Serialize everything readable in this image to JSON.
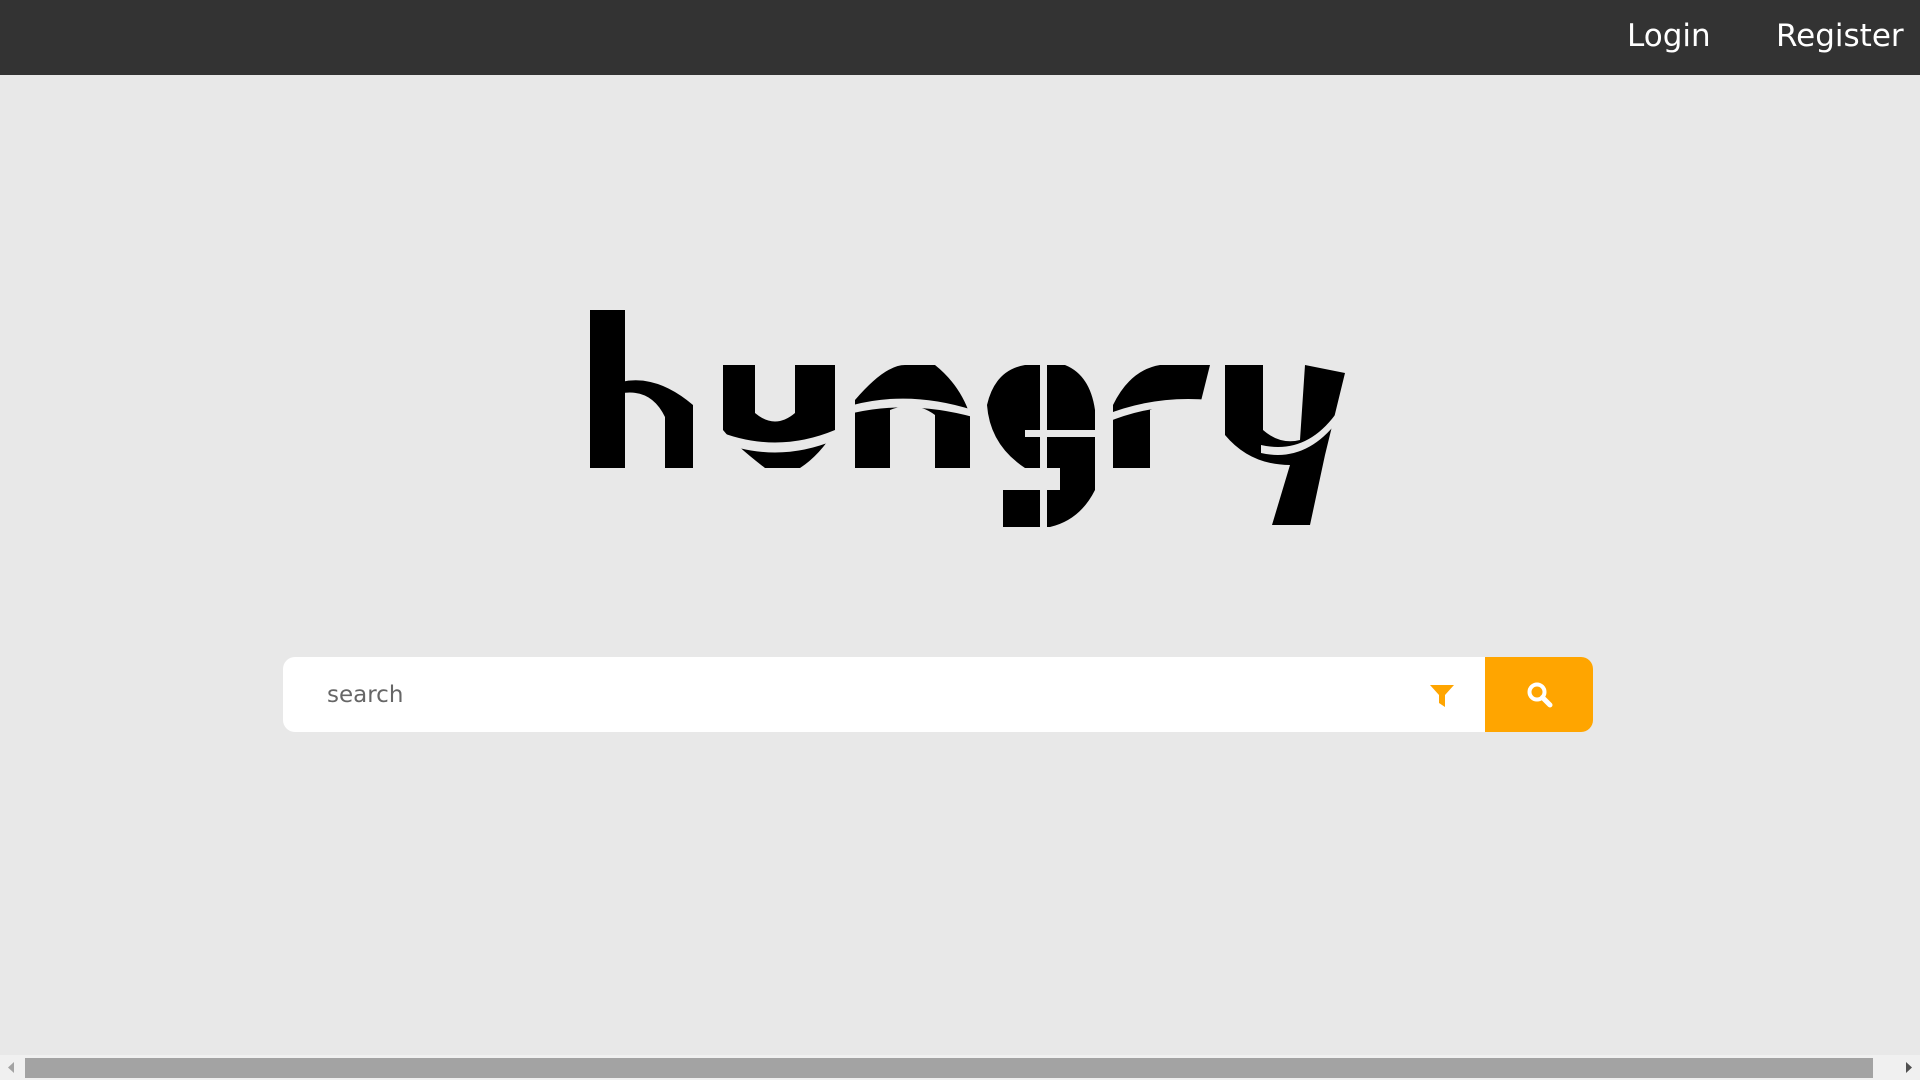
{
  "nav": {
    "login_label": "Login",
    "register_label": "Register"
  },
  "logo": {
    "text": "hungry",
    "icon": "hungry-wordmark-logo"
  },
  "search": {
    "placeholder": "search",
    "value": "",
    "filter_icon": "filter-icon",
    "button_icon": "search-icon"
  },
  "colors": {
    "topbar": "#333333",
    "background": "#e8e8e8",
    "accent": "#ffa500",
    "scroll_thumb": "#a3a3a3"
  }
}
